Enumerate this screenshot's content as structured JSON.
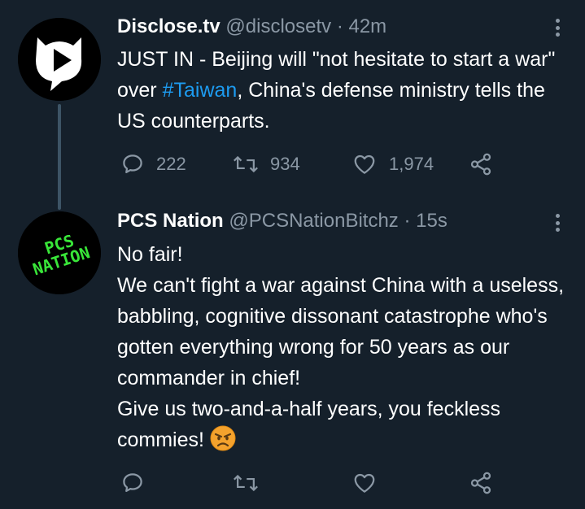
{
  "tweets": [
    {
      "display_name": "Disclose.tv",
      "handle": "@disclosetv",
      "separator": " · ",
      "time": "42m",
      "avatar_icon": "disclose-tv-play-logo",
      "text_before_hashtag": "JUST IN - Beijing will \"not hesitate to start a war\" over ",
      "hashtag": "#Taiwan",
      "text_after_hashtag": ", China's defense ministry tells the US counterparts.",
      "replies": "222",
      "retweets": "934",
      "likes": "1,974"
    },
    {
      "display_name": "PCS Nation",
      "handle": "@PCSNationBitchz",
      "separator": " · ",
      "time": "15s",
      "avatar_text_line1": "PCS",
      "avatar_text_line2": "NATION",
      "line1": "No fair!",
      "line2": "We can't fight a war against China with a useless, babbling, cognitive dissonant catastrophe who's gotten everything wrong for 50 years as our commander in chief!",
      "line3": "Give us two-and-a-half years, you feckless commies!",
      "emoji": "angry-face-emoji"
    }
  ],
  "colors": {
    "background": "#15202b",
    "text": "#ffffff",
    "secondary": "#8b98a5",
    "link": "#1d9bf0",
    "avatar_green": "#39e639"
  }
}
